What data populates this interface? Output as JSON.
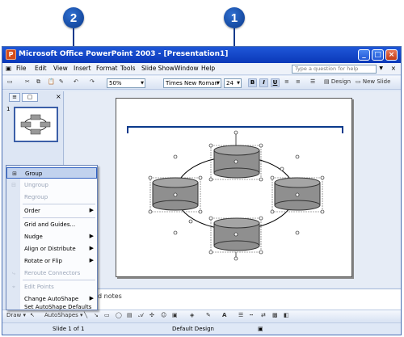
{
  "callouts": [
    "2",
    "1"
  ],
  "window": {
    "title": "Microsoft Office PowerPoint 2003 - [Presentation1]",
    "controls": [
      "_",
      "□",
      "×"
    ]
  },
  "menubar": {
    "items": [
      "File",
      "Edit",
      "View",
      "Insert",
      "Format",
      "Tools",
      "Slide Show",
      "Window",
      "Help"
    ],
    "ask_placeholder": "Type a question for help",
    "doc_close": "×"
  },
  "toolbar": {
    "zoom": "50%",
    "font_name": "Times New Roman",
    "font_size": "24",
    "bold": "B",
    "italic": "I",
    "underline": "U",
    "design_label": "Design",
    "new_slide_label": "New Slide"
  },
  "outline_pane": {
    "tab_close": "×",
    "slide_number": "1"
  },
  "notes": {
    "text": "d notes"
  },
  "context_menu": {
    "items": [
      {
        "label": "Group",
        "enabled": true,
        "submenu": false,
        "highlighted": true
      },
      {
        "label": "Ungroup",
        "enabled": false,
        "submenu": false
      },
      {
        "label": "Regroup",
        "enabled": false,
        "submenu": false
      },
      {
        "label": "Order",
        "enabled": true,
        "submenu": true
      },
      {
        "label": "Grid and Guides...",
        "enabled": true,
        "submenu": false
      },
      {
        "label": "Nudge",
        "enabled": true,
        "submenu": true
      },
      {
        "label": "Align or Distribute",
        "enabled": true,
        "submenu": true
      },
      {
        "label": "Rotate or Flip",
        "enabled": true,
        "submenu": true
      },
      {
        "label": "Reroute Connectors",
        "enabled": false,
        "submenu": false
      },
      {
        "label": "Edit Points",
        "enabled": false,
        "submenu": false
      },
      {
        "label": "Change AutoShape",
        "enabled": true,
        "submenu": true
      },
      {
        "label": "Set AutoShape Defaults",
        "enabled": true,
        "submenu": false
      }
    ]
  },
  "drawing_toolbar": {
    "draw_label": "Draw",
    "autoshapes_label": "AutoShapes",
    "font_color_glyph": "A"
  },
  "statusbar": {
    "slide_info": "Slide 1 of 1",
    "design": "Default Design"
  },
  "colors": {
    "callout": "#1a4fb0",
    "titlebar": "#0a38b8",
    "menu_highlight": "#c1d2ee",
    "shape_fill": "#8f8f8f"
  }
}
